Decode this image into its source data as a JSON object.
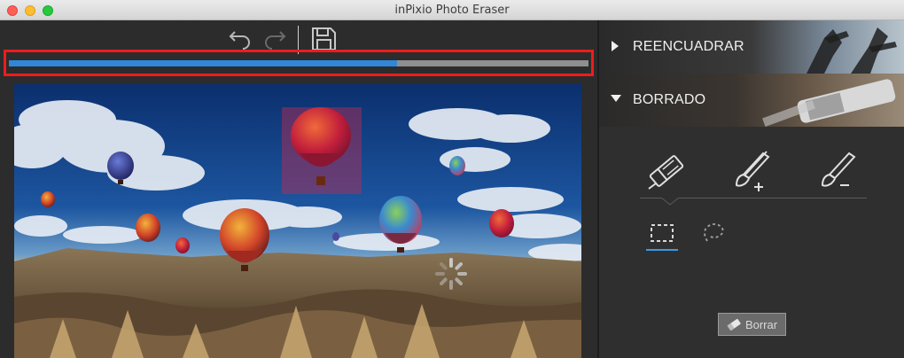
{
  "window": {
    "title": "inPixio Photo Eraser"
  },
  "toolbar": {
    "undo_icon": "undo-icon",
    "redo_icon": "redo-icon",
    "save_icon": "save-icon"
  },
  "progress": {
    "fraction": 0.67,
    "fill_color": "#2f87d8",
    "highlight_color": "#ee1c1c"
  },
  "panel": {
    "sections": [
      {
        "label": "REENCUADRAR",
        "expanded": false
      },
      {
        "label": "BORRADO",
        "expanded": true
      }
    ],
    "tools": [
      {
        "name": "eraser-icon",
        "selected": true
      },
      {
        "name": "brush-plus-icon",
        "selected": false
      },
      {
        "name": "brush-minus-icon",
        "selected": false
      }
    ],
    "selection_tools": [
      {
        "name": "rect-select-icon",
        "selected": true
      },
      {
        "name": "lasso-select-icon",
        "selected": false
      }
    ],
    "erase_button": "Borrar"
  },
  "colors": {
    "accent": "#3b9be8",
    "background": "#2b2b2b"
  }
}
